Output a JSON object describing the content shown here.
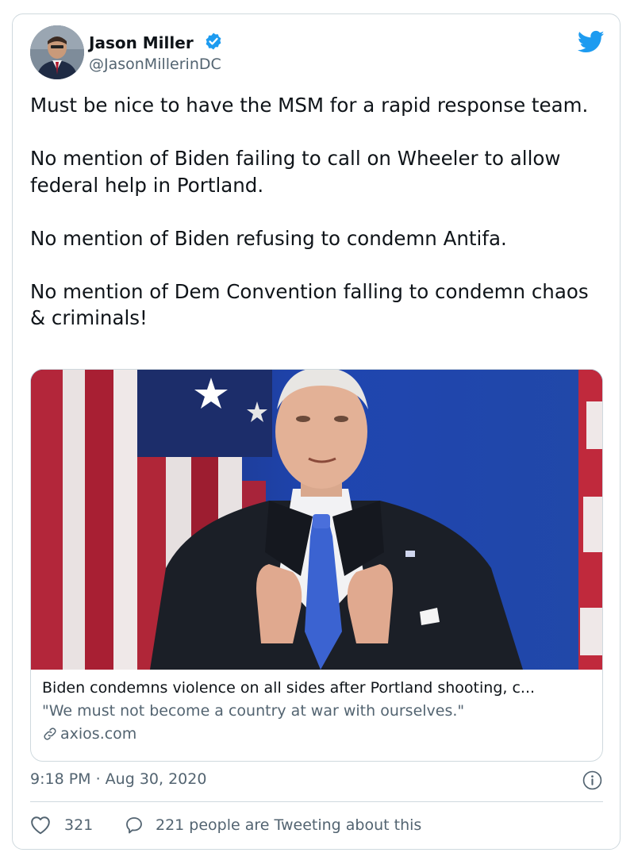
{
  "author": {
    "name": "Jason Miller",
    "handle": "@JasonMillerinDC"
  },
  "tweet": {
    "text": "Must be nice to have the MSM for a rapid response team.\n\nNo mention of Biden failing to call on Wheeler to allow federal help in Portland.\n\nNo mention of Biden refusing to condemn Antifa.\n\nNo mention of Dem Convention falling to condemn chaos & criminals!"
  },
  "link_card": {
    "title": "Biden condemns violence on all sides after Portland shooting, c...",
    "description": "\"We must not become a country at war with ourselves.\"",
    "domain": "axios.com"
  },
  "meta": {
    "timestamp": "9:18 PM · Aug 30, 2020"
  },
  "engagement": {
    "likes": "321",
    "replies": "221 people are Tweeting about this"
  },
  "colors": {
    "twitter_blue": "#1d9bf0",
    "secondary_text": "#536471",
    "border": "#cfd9de"
  },
  "icons": {
    "verified": "verified-badge-icon",
    "brand": "twitter-bird-icon",
    "link": "link-icon",
    "info": "info-icon",
    "like": "heart-icon",
    "reply": "speech-bubble-icon"
  }
}
